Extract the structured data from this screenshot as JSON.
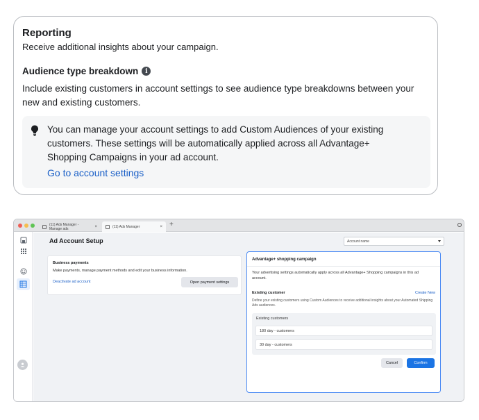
{
  "reporting": {
    "title": "Reporting",
    "subtitle": "Receive additional insights about your campaign.",
    "audience_title": "Audience type breakdown",
    "audience_desc": "Include existing customers in account settings to see audience type breakdowns between your new and existing customers.",
    "tip_text": "You can manage your account settings to add Custom Audiences of your existing customers. These settings will be automatically applied across all Advantage+ Shopping Campaigns in your ad account.",
    "tip_link": "Go to account settings"
  },
  "browser": {
    "tabs": [
      {
        "label": "(11) Ads Manager - Manage ads"
      },
      {
        "label": "(11) Ads Manager"
      }
    ],
    "close_glyph": "×",
    "new_tab_glyph": "+"
  },
  "page": {
    "title": "Ad Account Setup",
    "account_select": "Account name"
  },
  "business": {
    "title": "Business payments",
    "desc": "Make payments, manage payment methods and edit your business information.",
    "deactivate_link": "Deactivate ad account",
    "open_button": "Open payment settings"
  },
  "advantage": {
    "title": "Advantage+ shopping campaign",
    "desc": "Your advertising settings automatically apply across all Advantage+ Shopping campaigns in this ad account.",
    "existing_title": "Existing customer",
    "create_new": "Create New",
    "existing_desc": "Define your existing customers using Custom Audiences to receive additional insights about your Automated Shipping Ads audiences.",
    "box_label": "Existing customers",
    "options": [
      "180 day - customers",
      "30 day - customers"
    ],
    "cancel": "Cancel",
    "confirm": "Confirm"
  },
  "colors": {
    "link": "#1a5fc7",
    "primary_button": "#1b74e4",
    "focus_border": "#4a8af4"
  }
}
